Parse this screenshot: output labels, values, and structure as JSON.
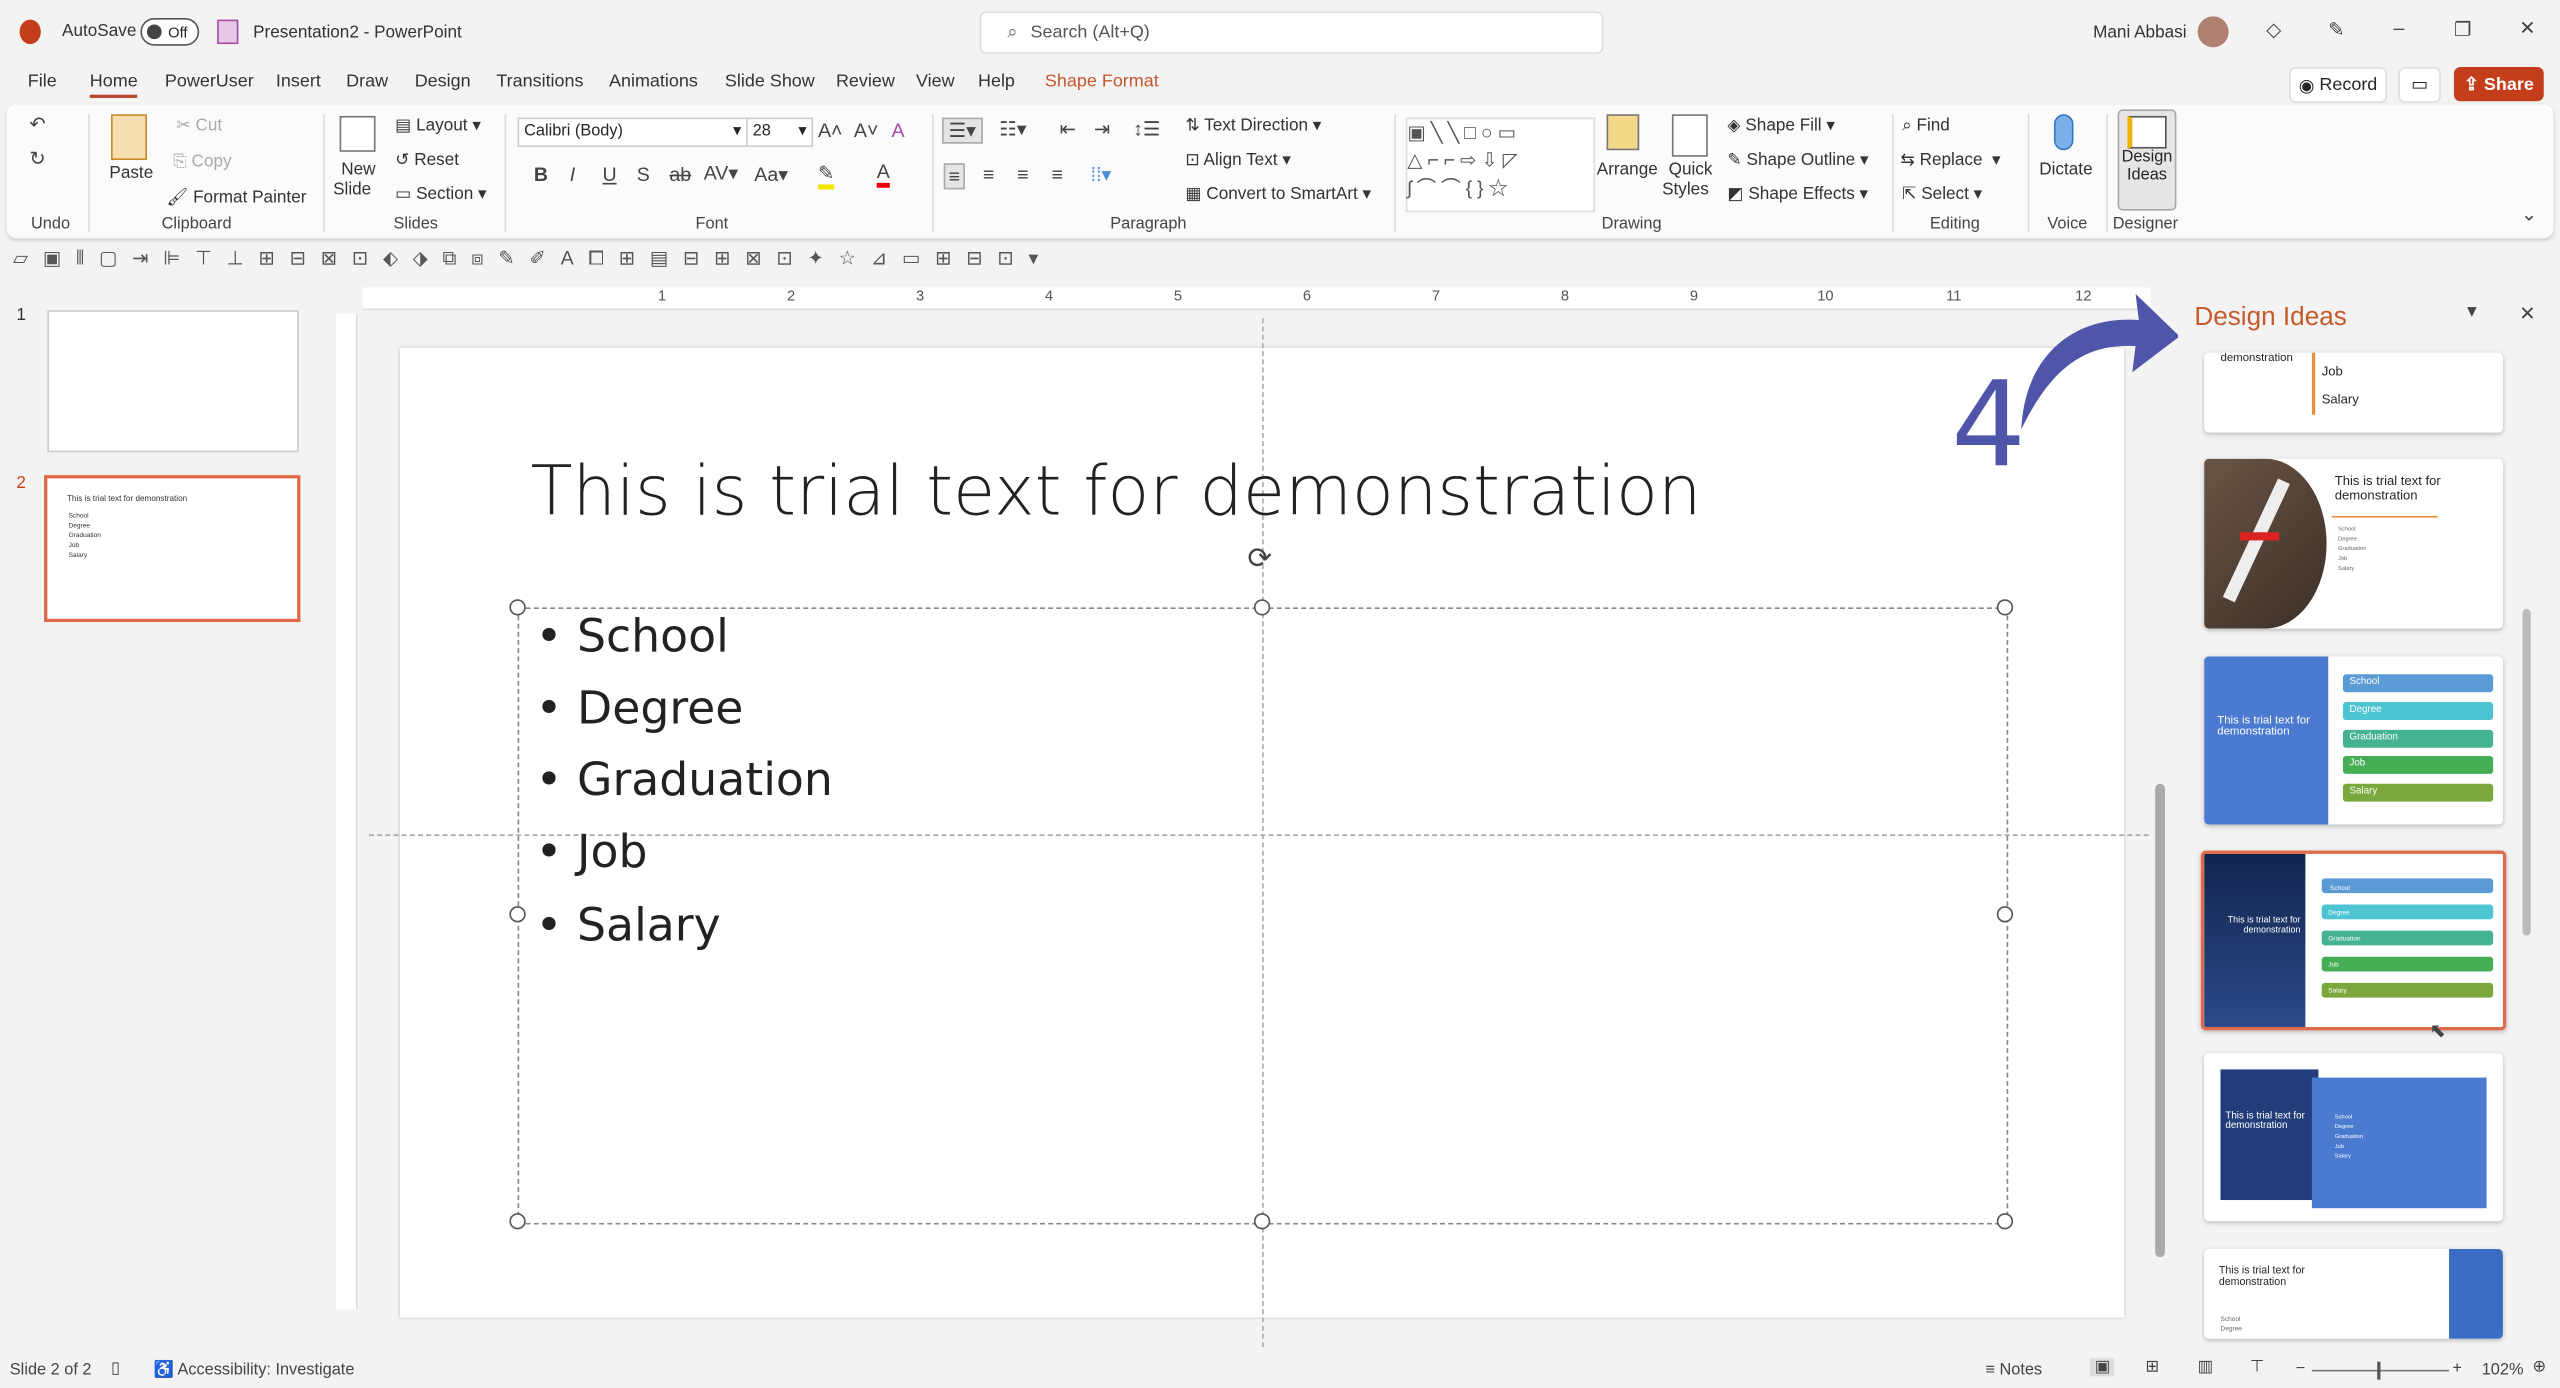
{
  "titlebar": {
    "autosave": "AutoSave",
    "toggle": "Off",
    "doc_title": "Presentation2 - PowerPoint",
    "search_placeholder": "Search (Alt+Q)",
    "user": "Mani Abbasi"
  },
  "tabs": [
    "File",
    "Home",
    "PowerUser",
    "Insert",
    "Draw",
    "Design",
    "Transitions",
    "Animations",
    "Slide Show",
    "Review",
    "View",
    "Help",
    "Shape Format"
  ],
  "actions": {
    "record": "Record",
    "share": "Share"
  },
  "ribbon": {
    "undo": {
      "group": "Undo"
    },
    "clipboard": {
      "paste": "Paste",
      "cut": "Cut",
      "copy": "Copy",
      "format_painter": "Format Painter",
      "group": "Clipboard"
    },
    "slides": {
      "new_slide": "New",
      "new_slide2": "Slide",
      "layout": "Layout",
      "reset": "Reset",
      "section": "Section",
      "group": "Slides"
    },
    "font": {
      "name": "Calibri (Body)",
      "size": "28",
      "group": "Font"
    },
    "paragraph": {
      "text_direction": "Text Direction",
      "align_text": "Align Text",
      "convert": "Convert to SmartArt",
      "group": "Paragraph"
    },
    "drawing": {
      "arrange": "Arrange",
      "quick": "Quick",
      "styles": "Styles",
      "fill": "Shape Fill",
      "outline": "Shape Outline",
      "effects": "Shape Effects",
      "group": "Drawing"
    },
    "editing": {
      "find": "Find",
      "replace": "Replace",
      "select": "Select",
      "group": "Editing"
    },
    "voice": {
      "dictate": "Dictate",
      "group": "Voice"
    },
    "designer": {
      "design": "Design",
      "ideas": "Ideas",
      "group": "Designer"
    }
  },
  "thumbnails": [
    {
      "num": "1"
    },
    {
      "num": "2",
      "title": "This is trial text for demonstration",
      "bullets": [
        "School",
        "Degree",
        "Graduation",
        "Job",
        "Salary"
      ]
    }
  ],
  "ruler": [
    "1",
    "2",
    "3",
    "4",
    "5",
    "6",
    "7",
    "8",
    "9",
    "10",
    "11",
    "12"
  ],
  "slide": {
    "title": "This is trial text for demonstration",
    "bullets": [
      "School",
      "Degree",
      "Graduation",
      "Job",
      "Salary"
    ]
  },
  "annotation": {
    "number": "4",
    "color": "#4f55a8"
  },
  "design_ideas": {
    "title": "Design Ideas",
    "card1": {
      "title_frag": "demonstration",
      "items": [
        "Job",
        "Salary"
      ]
    },
    "card_title": "This is trial text for demonstration",
    "card2_bullets": [
      "School",
      "Degree",
      "Graduation",
      "Job",
      "Salary"
    ],
    "items": [
      "School",
      "Degree",
      "Graduation",
      "Job",
      "Salary"
    ]
  },
  "status": {
    "slide": "Slide 2 of 2",
    "accessibility": "Accessibility: Investigate",
    "notes": "Notes",
    "zoom": "102%"
  },
  "colors": {
    "accent": "#c43e1c",
    "selection": "#e0694a"
  }
}
